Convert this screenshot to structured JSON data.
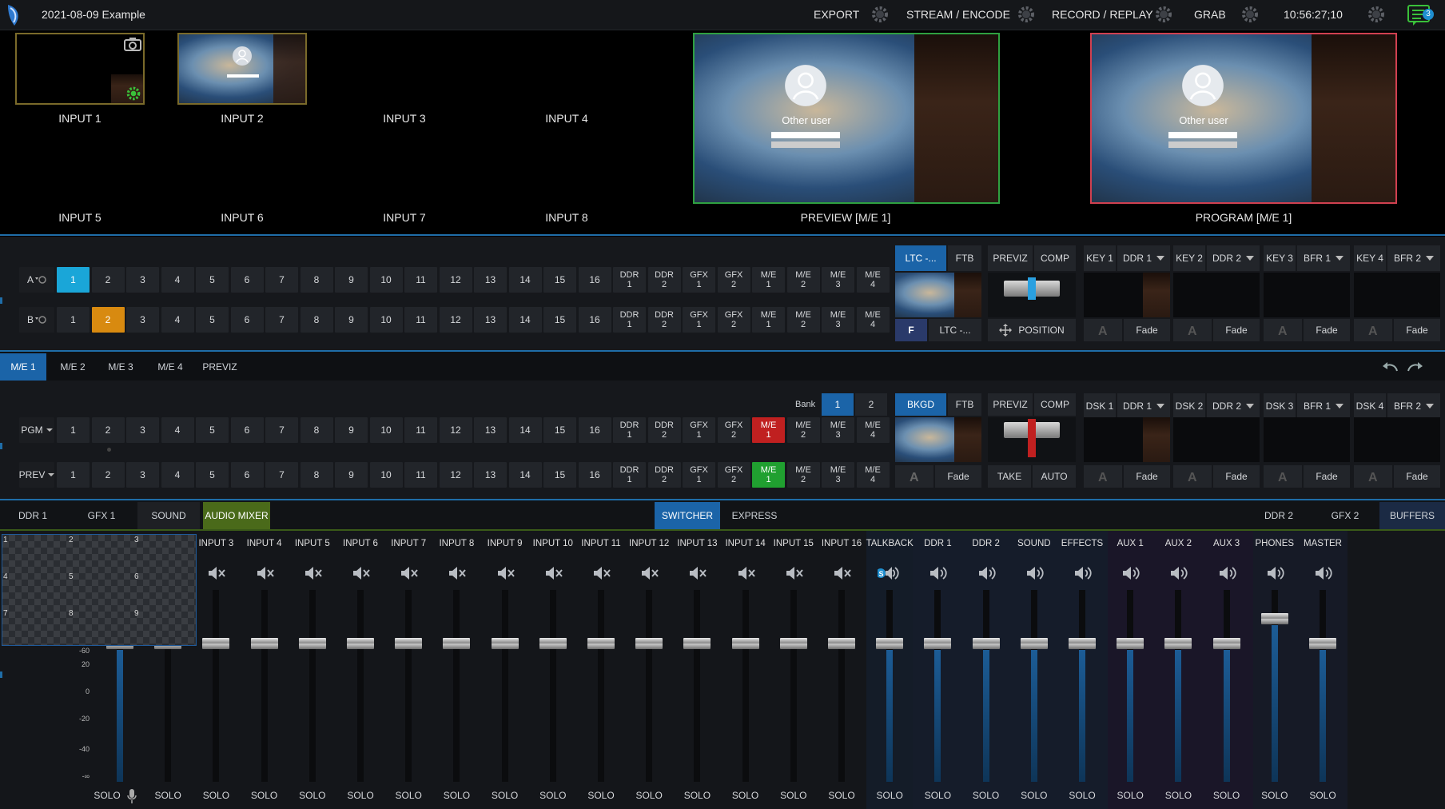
{
  "topbar": {
    "title": "2021-08-09 Example",
    "export": "EXPORT",
    "stream": "STREAM / ENCODE",
    "record": "RECORD / REPLAY",
    "grab": "GRAB",
    "clock": "10:56:27;10",
    "notifications": "3"
  },
  "monitors": {
    "inputs": [
      "INPUT 1",
      "INPUT 2",
      "INPUT 3",
      "INPUT 4",
      "INPUT 5",
      "INPUT 6",
      "INPUT 7",
      "INPUT 8"
    ],
    "preview": "PREVIEW [M/E 1]",
    "program": "PROGRAM [M/E 1]",
    "login_user": "Other user"
  },
  "me_top": {
    "row_a_label": "A",
    "row_b_label": "B",
    "nums": [
      "1",
      "2",
      "3",
      "4",
      "5",
      "6",
      "7",
      "8",
      "9",
      "10",
      "11",
      "12",
      "13",
      "14",
      "15",
      "16"
    ],
    "extra": [
      "DDR|1",
      "DDR|2",
      "GFX|1",
      "GFX|2",
      "M/E|1",
      "M/E|2",
      "M/E|3",
      "M/E|4"
    ]
  },
  "me_top_panel": {
    "ltc": "LTC -...",
    "ftb": "FTB",
    "previz": "PREVIZ",
    "comp": "COMP",
    "ltc2": "LTC -...",
    "position": "POSITION",
    "keys": [
      {
        "key": "KEY 1",
        "src": "DDR 1",
        "fade": "Fade"
      },
      {
        "key": "KEY 2",
        "src": "DDR 2",
        "fade": "Fade"
      },
      {
        "key": "KEY 3",
        "src": "BFR 1",
        "fade": "Fade"
      },
      {
        "key": "KEY 4",
        "src": "BFR 2",
        "fade": "Fade"
      }
    ]
  },
  "me_tabs": [
    "M/E 1",
    "M/E 2",
    "M/E 3",
    "M/E 4",
    "PREVIZ"
  ],
  "main_switcher": {
    "bank": "Bank",
    "bank1": "1",
    "bank2": "2",
    "pgm": "PGM",
    "prev": "PREV",
    "bkgd": "BKGD",
    "ftb": "FTB",
    "previz": "PREVIZ",
    "comp": "COMP",
    "fade": "Fade",
    "take": "TAKE",
    "auto": "AUTO",
    "dsks": [
      {
        "key": "DSK 1",
        "src": "DDR 1",
        "fade": "Fade"
      },
      {
        "key": "DSK 2",
        "src": "DDR 2",
        "fade": "Fade"
      },
      {
        "key": "DSK 3",
        "src": "BFR 1",
        "fade": "Fade"
      },
      {
        "key": "DSK 4",
        "src": "BFR 2",
        "fade": "Fade"
      }
    ]
  },
  "bottom_tabs": {
    "left": [
      "DDR 1",
      "GFX 1",
      "SOUND",
      "AUDIO MIXER"
    ],
    "center": [
      "SWITCHER",
      "EXPRESS"
    ],
    "right": [
      "DDR 2",
      "GFX 2",
      "BUFFERS"
    ]
  },
  "multiview_cells": [
    "1",
    "2",
    "3",
    "4",
    "5",
    "6",
    "7",
    "8",
    "9"
  ],
  "mixer": {
    "scale": [
      "-60",
      "20",
      "0",
      "-20",
      "-40",
      "-∞"
    ],
    "solo": "SOLO",
    "channels": [
      {
        "name": "",
        "level": 0.72,
        "group": "in",
        "muted": true
      },
      {
        "name": "",
        "level": 0.72,
        "group": "in",
        "muted": true
      },
      {
        "name": "INPUT 3",
        "level": 0.72,
        "group": "in",
        "muted": true
      },
      {
        "name": "INPUT 4",
        "level": 0.72,
        "group": "in",
        "muted": true
      },
      {
        "name": "INPUT 5",
        "level": 0.72,
        "group": "in",
        "muted": true
      },
      {
        "name": "INPUT 6",
        "level": 0.72,
        "group": "in",
        "muted": true
      },
      {
        "name": "INPUT 7",
        "level": 0.72,
        "group": "in",
        "muted": true
      },
      {
        "name": "INPUT 8",
        "level": 0.72,
        "group": "in",
        "muted": true
      },
      {
        "name": "INPUT 9",
        "level": 0.72,
        "group": "in",
        "muted": true
      },
      {
        "name": "INPUT 10",
        "level": 0.72,
        "group": "in",
        "muted": true
      },
      {
        "name": "INPUT 11",
        "level": 0.72,
        "group": "in",
        "muted": true
      },
      {
        "name": "INPUT 12",
        "level": 0.72,
        "group": "in",
        "muted": true
      },
      {
        "name": "INPUT 13",
        "level": 0.72,
        "group": "in",
        "muted": true
      },
      {
        "name": "INPUT 14",
        "level": 0.72,
        "group": "in",
        "muted": true
      },
      {
        "name": "INPUT 15",
        "level": 0.72,
        "group": "in",
        "muted": true
      },
      {
        "name": "INPUT 16",
        "level": 0.72,
        "group": "in",
        "muted": true
      },
      {
        "name": "TALKBACK",
        "level": 0.72,
        "group": "tb",
        "muted": false
      },
      {
        "name": "DDR 1",
        "level": 0.72,
        "group": "int",
        "muted": false
      },
      {
        "name": "DDR 2",
        "level": 0.72,
        "group": "int",
        "muted": false
      },
      {
        "name": "SOUND",
        "level": 0.72,
        "group": "int",
        "muted": false
      },
      {
        "name": "EFFECTS",
        "level": 0.72,
        "group": "int",
        "muted": false
      },
      {
        "name": "AUX 1",
        "level": 0.72,
        "group": "aux",
        "muted": false
      },
      {
        "name": "AUX 2",
        "level": 0.72,
        "group": "aux",
        "muted": false
      },
      {
        "name": "AUX 3",
        "level": 0.72,
        "group": "aux",
        "muted": false
      },
      {
        "name": "PHONES",
        "level": 0.85,
        "group": "mst",
        "muted": false
      },
      {
        "name": "MASTER",
        "level": 0.72,
        "group": "mst",
        "muted": false
      }
    ]
  },
  "colors": {
    "accent": "#1f8fd0",
    "pgm_red": "#c02020",
    "prev_green": "#20a030",
    "selected_a": "#1aa6d8",
    "selected_b": "#d88a10"
  }
}
